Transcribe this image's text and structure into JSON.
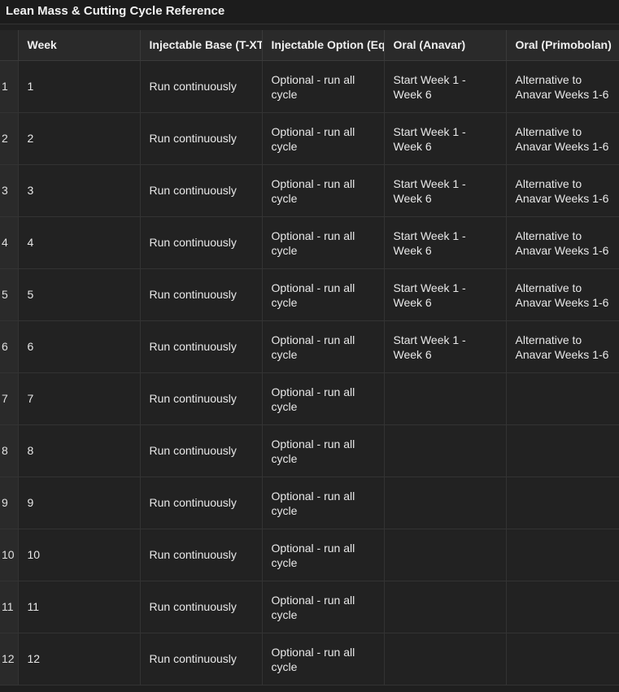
{
  "title": "Lean Mass & Cutting Cycle Reference",
  "columns": [
    "Week",
    "Injectable Base (T-XT (",
    "Injectable Option (Equ",
    "Oral (Anavar)",
    "Oral (Primobolan)"
  ],
  "rows": [
    {
      "idx": "1",
      "week": "1",
      "base": "Run continuously",
      "option": "Optional - run all cycle",
      "anavar": "Start Week 1 - Week 6",
      "primo": "Alternative to Anavar Weeks 1-6"
    },
    {
      "idx": "2",
      "week": "2",
      "base": "Run continuously",
      "option": "Optional - run all cycle",
      "anavar": "Start Week 1 - Week 6",
      "primo": "Alternative to Anavar Weeks 1-6"
    },
    {
      "idx": "3",
      "week": "3",
      "base": "Run continuously",
      "option": "Optional - run all cycle",
      "anavar": "Start Week 1 - Week 6",
      "primo": "Alternative to Anavar Weeks 1-6"
    },
    {
      "idx": "4",
      "week": "4",
      "base": "Run continuously",
      "option": "Optional - run all cycle",
      "anavar": "Start Week 1 - Week 6",
      "primo": "Alternative to Anavar Weeks 1-6"
    },
    {
      "idx": "5",
      "week": "5",
      "base": "Run continuously",
      "option": "Optional - run all cycle",
      "anavar": "Start Week 1 - Week 6",
      "primo": "Alternative to Anavar Weeks 1-6"
    },
    {
      "idx": "6",
      "week": "6",
      "base": "Run continuously",
      "option": "Optional - run all cycle",
      "anavar": "Start Week 1 - Week 6",
      "primo": "Alternative to Anavar Weeks 1-6"
    },
    {
      "idx": "7",
      "week": "7",
      "base": "Run continuously",
      "option": "Optional - run all cycle",
      "anavar": "",
      "primo": ""
    },
    {
      "idx": "8",
      "week": "8",
      "base": "Run continuously",
      "option": "Optional - run all cycle",
      "anavar": "",
      "primo": ""
    },
    {
      "idx": "9",
      "week": "9",
      "base": "Run continuously",
      "option": "Optional - run all cycle",
      "anavar": "",
      "primo": ""
    },
    {
      "idx": "10",
      "week": "10",
      "base": "Run continuously",
      "option": "Optional - run all cycle",
      "anavar": "",
      "primo": ""
    },
    {
      "idx": "11",
      "week": "11",
      "base": "Run continuously",
      "option": "Optional - run all cycle",
      "anavar": "",
      "primo": ""
    },
    {
      "idx": "12",
      "week": "12",
      "base": "Run continuously",
      "option": "Optional - run all cycle",
      "anavar": "",
      "primo": ""
    }
  ]
}
